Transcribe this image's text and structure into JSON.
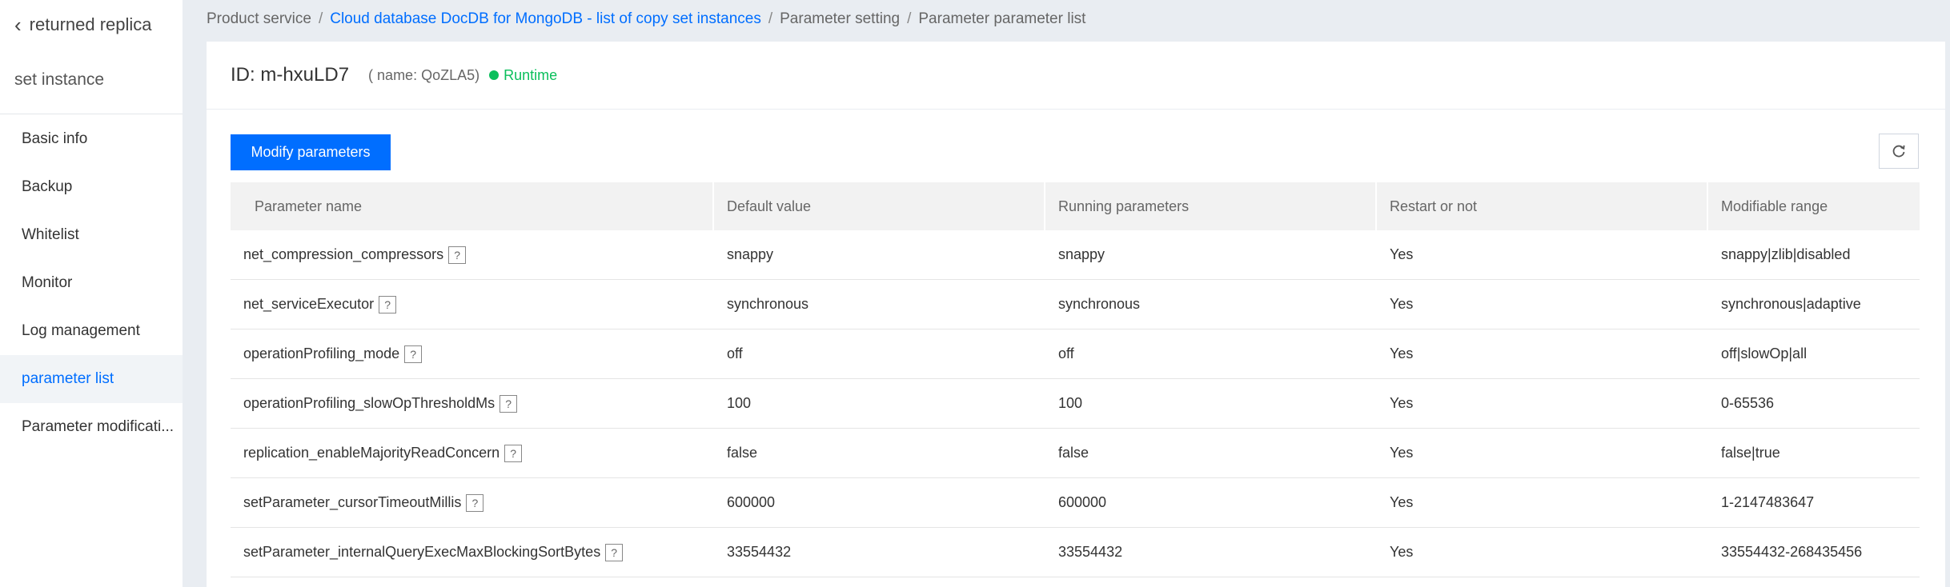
{
  "sidebar": {
    "back_label": "returned replica",
    "instance_title": "set instance",
    "items": [
      {
        "label": "Basic info",
        "active": false
      },
      {
        "label": "Backup",
        "active": false
      },
      {
        "label": "Whitelist",
        "active": false
      },
      {
        "label": "Monitor",
        "active": false
      },
      {
        "label": "Log management",
        "active": false
      },
      {
        "label": "parameter list",
        "active": true
      },
      {
        "label": "Parameter modificati...",
        "active": false
      }
    ]
  },
  "breadcrumb": {
    "items": [
      "Product service",
      "Cloud database DocDB for MongoDB - list of copy set instances",
      "Parameter setting",
      "Parameter parameter list"
    ],
    "separator": "/"
  },
  "instance": {
    "id_label": "ID: m-hxuLD7",
    "name_label": "( name: QoZLA5)",
    "status": "Runtime",
    "status_color": "#0abf5b"
  },
  "toolbar": {
    "modify_label": "Modify parameters",
    "refresh_icon": "refresh-icon"
  },
  "table": {
    "columns": [
      "Parameter name",
      "Default value",
      "Running parameters",
      "Restart or not",
      "Modifiable range"
    ],
    "rows": [
      {
        "name": "net_compression_compressors",
        "default": "snappy",
        "running": "snappy",
        "restart": "Yes",
        "range": "snappy|zlib|disabled"
      },
      {
        "name": "net_serviceExecutor",
        "default": "synchronous",
        "running": "synchronous",
        "restart": "Yes",
        "range": "synchronous|adaptive"
      },
      {
        "name": "operationProfiling_mode",
        "default": "off",
        "running": "off",
        "restart": "Yes",
        "range": "off|slowOp|all"
      },
      {
        "name": "operationProfiling_slowOpThresholdMs",
        "default": "100",
        "running": "100",
        "restart": "Yes",
        "range": "0-65536"
      },
      {
        "name": "replication_enableMajorityReadConcern",
        "default": "false",
        "running": "false",
        "restart": "Yes",
        "range": "false|true"
      },
      {
        "name": "setParameter_cursorTimeoutMillis",
        "default": "600000",
        "running": "600000",
        "restart": "Yes",
        "range": "1-2147483647"
      },
      {
        "name": "setParameter_internalQueryExecMaxBlockingSortBytes",
        "default": "33554432",
        "running": "33554432",
        "restart": "Yes",
        "range": "33554432-268435456"
      }
    ],
    "help_glyph": "?"
  },
  "colors": {
    "accent": "#006eff",
    "sidebar_active_bg": "#f1f4f7"
  }
}
